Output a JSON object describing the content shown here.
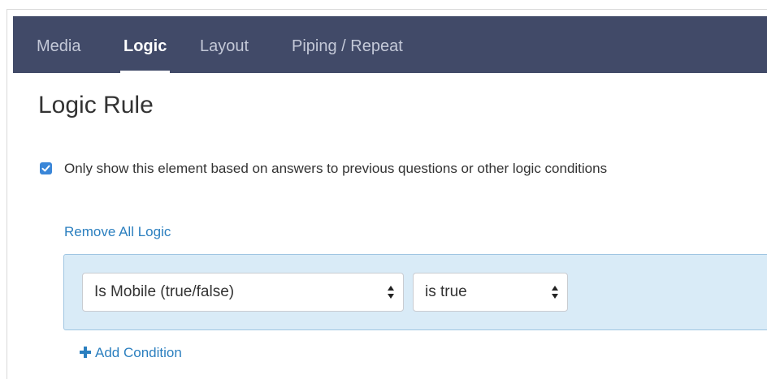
{
  "tabs": [
    {
      "label": "Media",
      "active": false
    },
    {
      "label": "Logic",
      "active": true
    },
    {
      "label": "Layout",
      "active": false
    },
    {
      "label": "Piping / Repeat",
      "active": false
    }
  ],
  "page_title": "Logic Rule",
  "show_condition": {
    "checked": true,
    "label": "Only show this element based on answers to previous questions or other logic conditions"
  },
  "remove_all_logic_label": "Remove All Logic",
  "condition": {
    "question_select": "Is Mobile (true/false)",
    "operator_select": "is true"
  },
  "add_condition_label": "Add Condition",
  "colors": {
    "tabbar_bg": "#414a68",
    "link": "#2b7fbf",
    "condition_bg": "#d9ebf7",
    "checkbox": "#3a86d8"
  },
  "icons": [
    "check-icon",
    "select-arrows-icon",
    "plus-icon"
  ]
}
